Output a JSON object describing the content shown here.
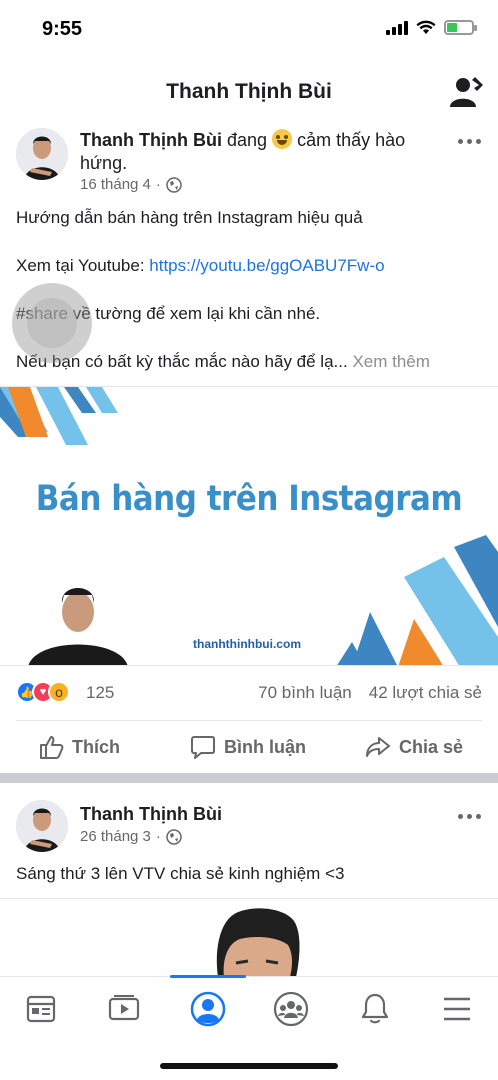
{
  "status_bar": {
    "time": "9:55"
  },
  "header": {
    "title": "Thanh Thịnh Bùi",
    "icon": "profile-settings-icon"
  },
  "post1": {
    "author": "Thanh Thịnh Bùi",
    "feeling_prefix": "đang",
    "feeling_line1": "cảm thấy hào",
    "feeling_line2": "hứng.",
    "date": "16 tháng 4",
    "line1": "Hướng dẫn bán hàng trên Instagram hiệu quả",
    "line2_prefix": "Xem tại Youtube: ",
    "line2_link": "https://youtu.be/ggOABU7Fw-o",
    "line3": "#share về tường để xem lại khi cần nhé.",
    "line4": "Nếu bạn có bất kỳ thắc mắc nào hãy để lạ...",
    "see_more": "Xem thêm",
    "media": {
      "title": "Bán hàng trên Instagram",
      "site": "thanhthinhbui.com",
      "colors": {
        "orange": "#f08a2c",
        "light_blue": "#74c2ea",
        "dark_blue": "#3d86c2"
      }
    },
    "reactions": {
      "count": "125",
      "comments": "70 bình luận",
      "shares": "42 lượt chia sẻ"
    },
    "actions": {
      "like": "Thích",
      "comment": "Bình luận",
      "share": "Chia sẻ"
    }
  },
  "post2": {
    "author": "Thanh Thịnh Bùi",
    "date": "26 tháng 3",
    "text": "Sáng thứ 3 lên VTV chia sẻ kinh nghiệm <3"
  },
  "bottom_nav": {
    "items": [
      "news-feed-icon",
      "watch-icon",
      "profile-icon",
      "groups-icon",
      "notifications-icon",
      "menu-icon"
    ],
    "active": "profile-icon"
  },
  "colors": {
    "accent": "#1877f2",
    "text": "#1c1e21",
    "secondary": "#65676b"
  }
}
